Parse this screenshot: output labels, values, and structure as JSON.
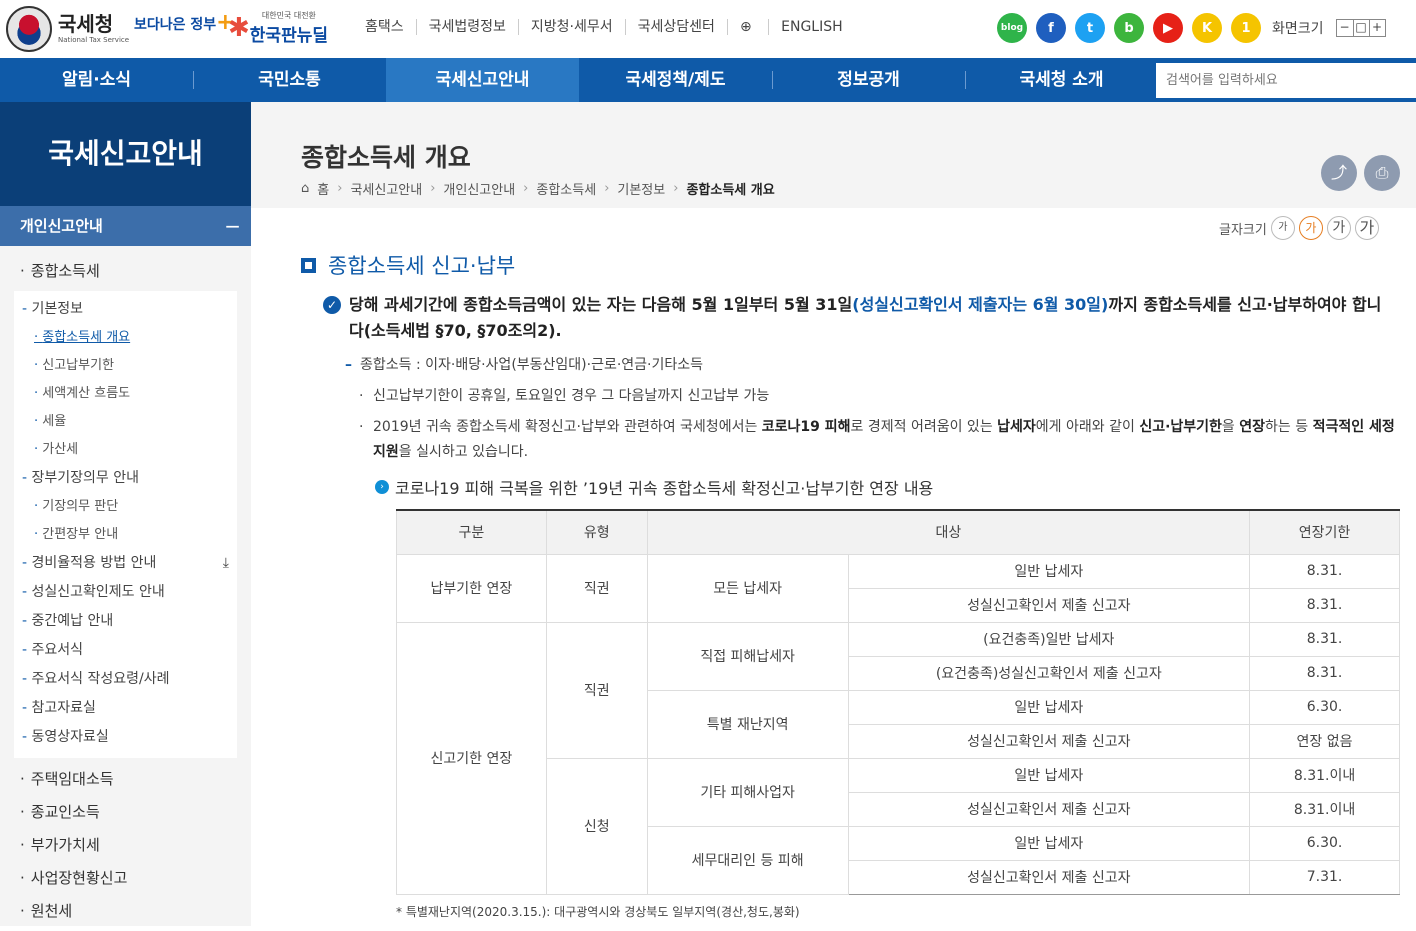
{
  "header": {
    "logo_main": "국세청",
    "logo_sub": "National Tax Service",
    "slogan1": "보다나은 정부",
    "slogan2_small": "대한민국 대전환",
    "slogan2_big": "한국판뉴딜",
    "util_links": [
      "홈택스",
      "국세법령정보",
      "지방청·세무서",
      "국세상담센터",
      "ENGLISH"
    ],
    "sns": [
      {
        "name": "blog",
        "label": "blog",
        "color": "#2fb44a"
      },
      {
        "name": "facebook",
        "label": "f",
        "color": "#1f5fbf"
      },
      {
        "name": "twitter",
        "label": "t",
        "color": "#1da1f2"
      },
      {
        "name": "band",
        "label": "b",
        "color": "#3db53d"
      },
      {
        "name": "youtube",
        "label": "▶",
        "color": "#e62117"
      },
      {
        "name": "kakao",
        "label": "K",
        "color": "#f5c400"
      },
      {
        "name": "one",
        "label": "1",
        "color": "#f5c400"
      }
    ],
    "screen_size_label": "화면크기",
    "screen_size_controls": [
      "−",
      "□",
      "+"
    ]
  },
  "gnb": {
    "items": [
      "알림·소식",
      "국민소통",
      "국세신고안내",
      "국세정책/제도",
      "정보공개",
      "국세청 소개"
    ],
    "active_index": 2,
    "search_placeholder": "검색어를 입력하세요"
  },
  "lnb": {
    "title": "국세신고안내",
    "section": "개인신고안내",
    "section_toggle": "−",
    "top_item": "종합소득세",
    "sub_basic": "기본정보",
    "basic_items": [
      "종합소득세 개요",
      "신고납부기한",
      "세액계산 흐름도",
      "세율",
      "가산세"
    ],
    "sub_bookkeeping": "장부기장의무 안내",
    "bookkeeping_items": [
      "기장의무 판단",
      "간편장부 안내"
    ],
    "other_subs": [
      "경비율적용 방법 안내",
      "성실신고확인제도 안내",
      "중간예납 안내",
      "주요서식",
      "주요서식 작성요령/사례",
      "참고자료실",
      "동영상자료실"
    ],
    "after_items": [
      "주택임대소득",
      "종교인소득",
      "부가가치세",
      "사업장현황신고",
      "원천세"
    ]
  },
  "main": {
    "page_title": "종합소득세 개요",
    "breadcrumb": [
      "홈",
      "국세신고안내",
      "개인신고안내",
      "종합소득세",
      "기본정보",
      "종합소득세 개요"
    ],
    "font_size_label": "글자크기",
    "font_size_buttons": [
      "가",
      "가",
      "가",
      "가"
    ],
    "section_title": "종합소득세 신고·납부",
    "lead_a": "당해 과세기간에 종합소득금액이 있는 자는 다음해 5월 1일부터 5월 31일",
    "lead_b": "(성실신고확인서 제출자는 6월 30일)",
    "lead_c": "까지 종합소득세를 신고·납부하여야 합니다(소득세법 §70, §70조의2).",
    "dash_item": "종합소득 : 이자·배당·사업(부동산임대)·근로·연금·기타소득",
    "bullet1": "신고납부기한이 공휴일, 토요일인 경우 그 다음날까지 신고납부 가능",
    "bullet2_parts": [
      "2019년 귀속 종합소득세 확정신고·납부와 관련하여 국세청에서는 ",
      "코로나19 피해",
      "로 경제적 어려움이 있는 ",
      "납세자",
      "에게 아래와 같이 ",
      "신고·납부기한",
      "을 ",
      "연장",
      "하는 등 ",
      "적극적인 세정지원",
      "을 실시하고 있습니다."
    ],
    "sub_heading": "코로나19 피해 극복을 위한 ’19년 귀속 종합소득세 확정신고·납부기한 연장 내용",
    "table": {
      "headers": [
        "구분",
        "유형",
        "대상",
        "연장기한"
      ],
      "cat1": "납부기한 연장",
      "cat2": "신고기한 연장",
      "type_direct": "직권",
      "type_apply": "신청",
      "groups": [
        "모든 납세자",
        "직접 피해납세자",
        "특별 재난지역",
        "기타 피해사업자",
        "세무대리인 등 피해"
      ],
      "targets": [
        "일반 납세자",
        "성실신고확인서 제출 신고자",
        "(요건충족)일반 납세자",
        "(요건충족)성실신고확인서 제출 신고자",
        "일반 납세자",
        "성실신고확인서 제출 신고자",
        "일반 납세자",
        "성실신고확인서 제출 신고자",
        "일반 납세자",
        "성실신고확인서 제출 신고자"
      ],
      "deadlines": [
        "8.31.",
        "8.31.",
        "8.31.",
        "8.31.",
        "6.30.",
        "연장 없음",
        "8.31.이내",
        "8.31.이내",
        "6.30.",
        "7.31."
      ]
    },
    "footnote": "* 특별재난지역(2020.3.15.): 대구광역시와 경상북도 일부지역(경산,청도,봉화)"
  }
}
